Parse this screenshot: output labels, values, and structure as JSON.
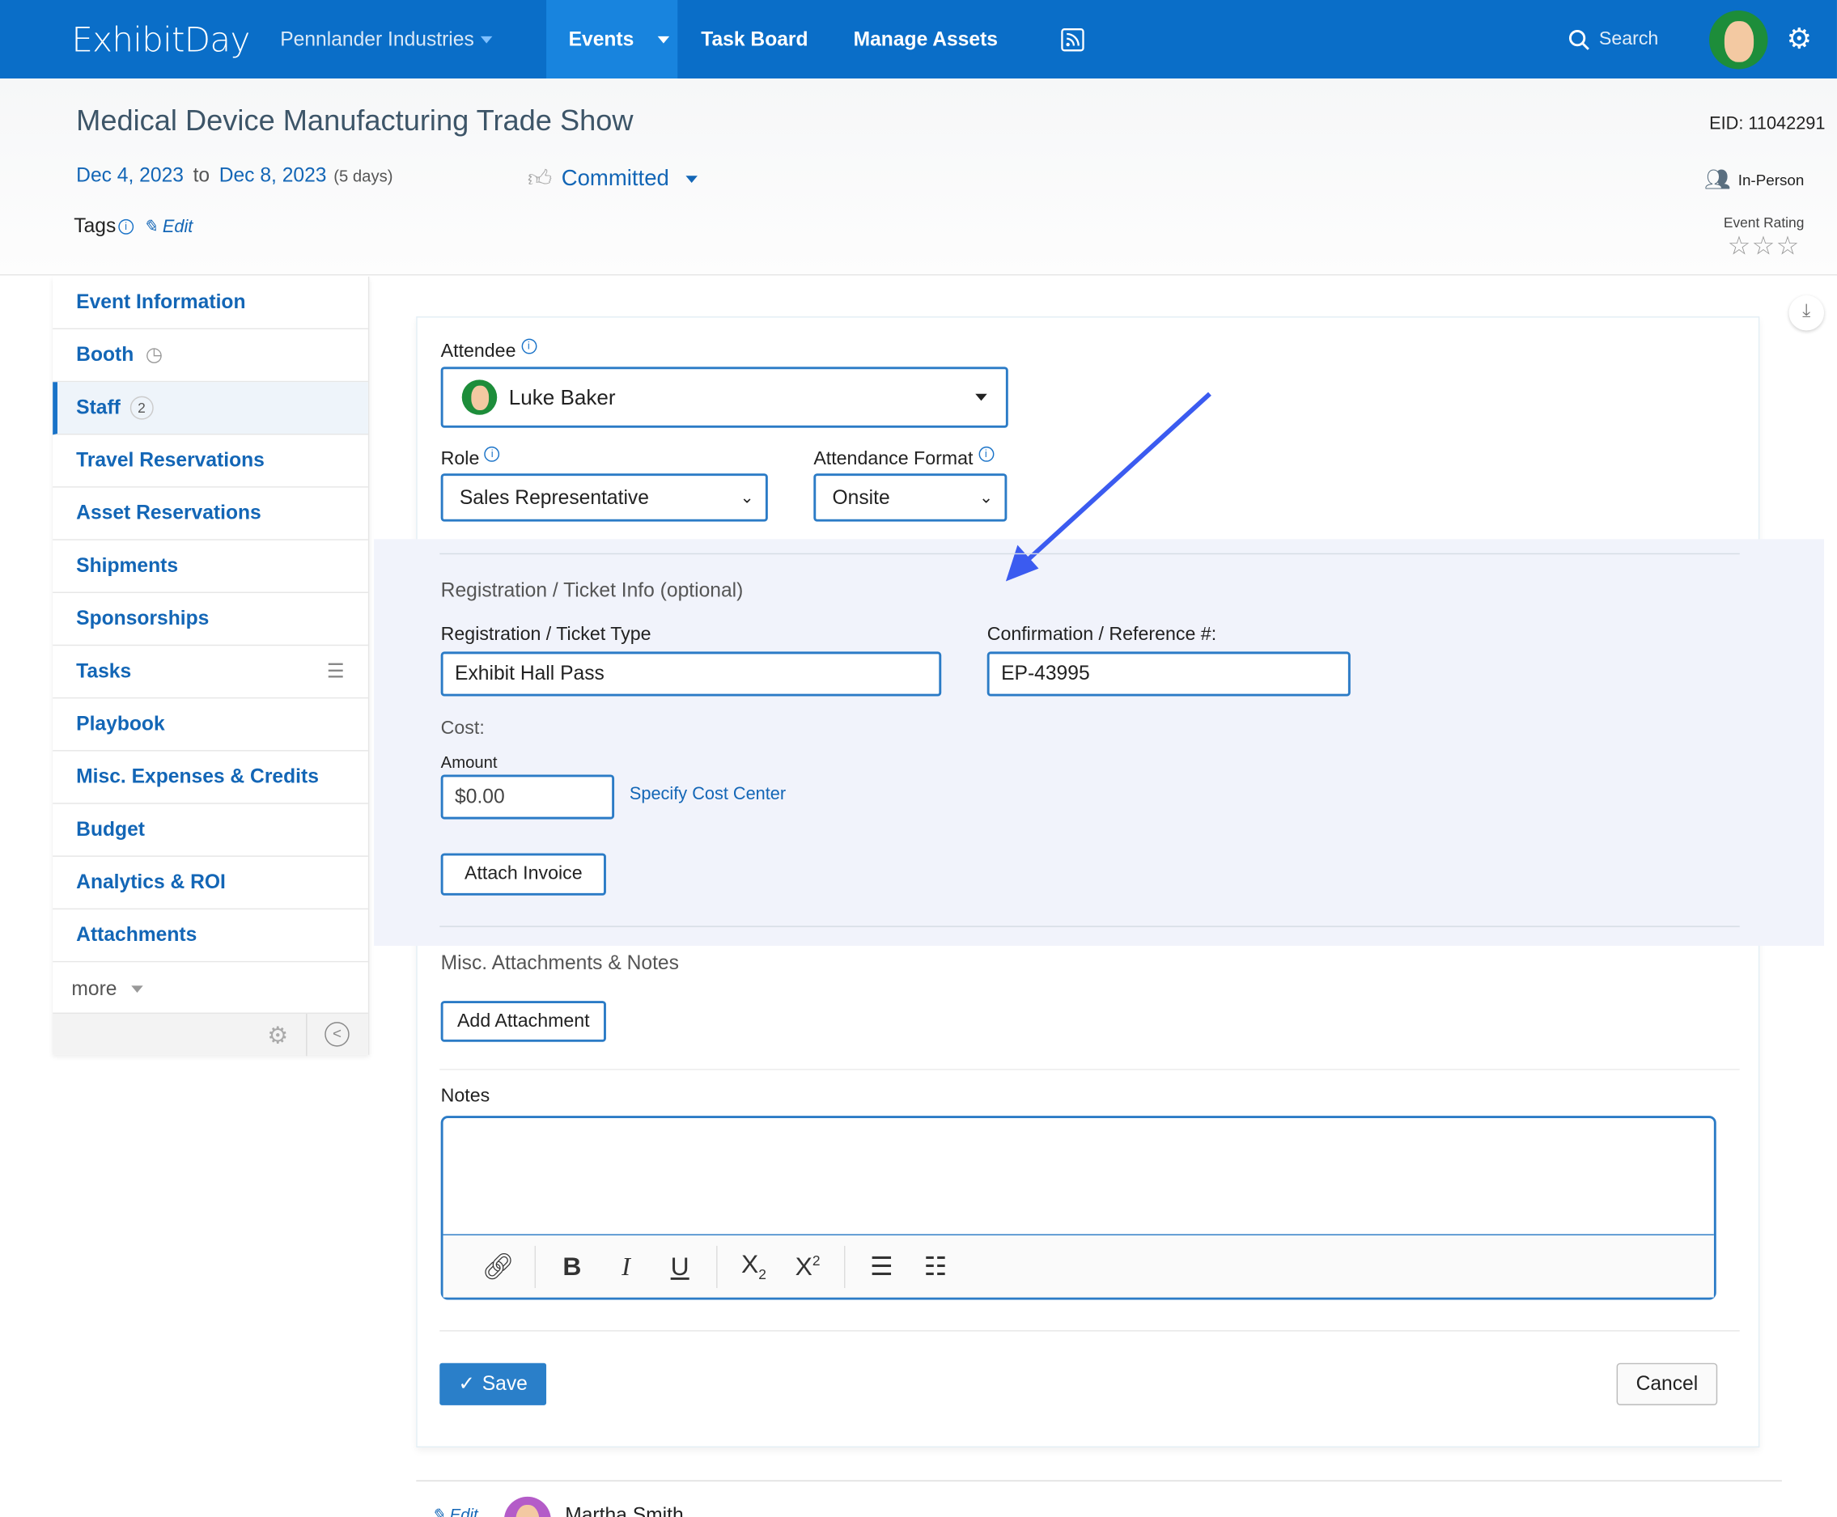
{
  "topbar": {
    "logo": "ExhibitDay",
    "org": "Pennlander Industries",
    "nav": [
      "Events",
      "Task Board",
      "Manage Assets"
    ],
    "search": "Search",
    "accent": "#0a6ec8"
  },
  "event": {
    "title": "Medical Device Manufacturing Trade Show",
    "eid": "EID: 11042291",
    "start": "Dec 4, 2023",
    "to": "to",
    "end": "Dec 8, 2023",
    "days": "(5 days)",
    "status": "Committed",
    "format": "In-Person",
    "tags_label": "Tags",
    "edit": "Edit",
    "rating_label": "Event Rating",
    "rating": 0,
    "rating_max": 3
  },
  "sidebar": {
    "items": [
      {
        "label": "Event Information"
      },
      {
        "label": "Booth"
      },
      {
        "label": "Staff",
        "badge": "2"
      },
      {
        "label": "Travel Reservations"
      },
      {
        "label": "Asset Reservations"
      },
      {
        "label": "Shipments"
      },
      {
        "label": "Sponsorships"
      },
      {
        "label": "Tasks"
      },
      {
        "label": "Playbook"
      },
      {
        "label": "Misc. Expenses & Credits"
      },
      {
        "label": "Budget"
      },
      {
        "label": "Analytics & ROI"
      },
      {
        "label": "Attachments"
      }
    ],
    "more": "more"
  },
  "form": {
    "attendee_label": "Attendee",
    "attendee": "Luke Baker",
    "role_label": "Role",
    "role": "Sales Representative",
    "format_label": "Attendance Format",
    "format": "Onsite",
    "reg_section": "Registration / Ticket Info (optional)",
    "ticket_label": "Registration / Ticket Type",
    "ticket": "Exhibit Hall Pass",
    "conf_label": "Confirmation / Reference #:",
    "conf": "EP-43995",
    "cost_label": "Cost:",
    "amount_label": "Amount",
    "amount": "$0.00",
    "cost_center": "Specify Cost Center",
    "attach_invoice": "Attach Invoice",
    "misc_section": "Misc. Attachments & Notes",
    "add_attachment": "Add Attachment",
    "notes_label": "Notes",
    "notes": "",
    "save": "Save",
    "cancel": "Cancel"
  },
  "next": {
    "edit": "Edit",
    "name": "Martha Smith"
  }
}
